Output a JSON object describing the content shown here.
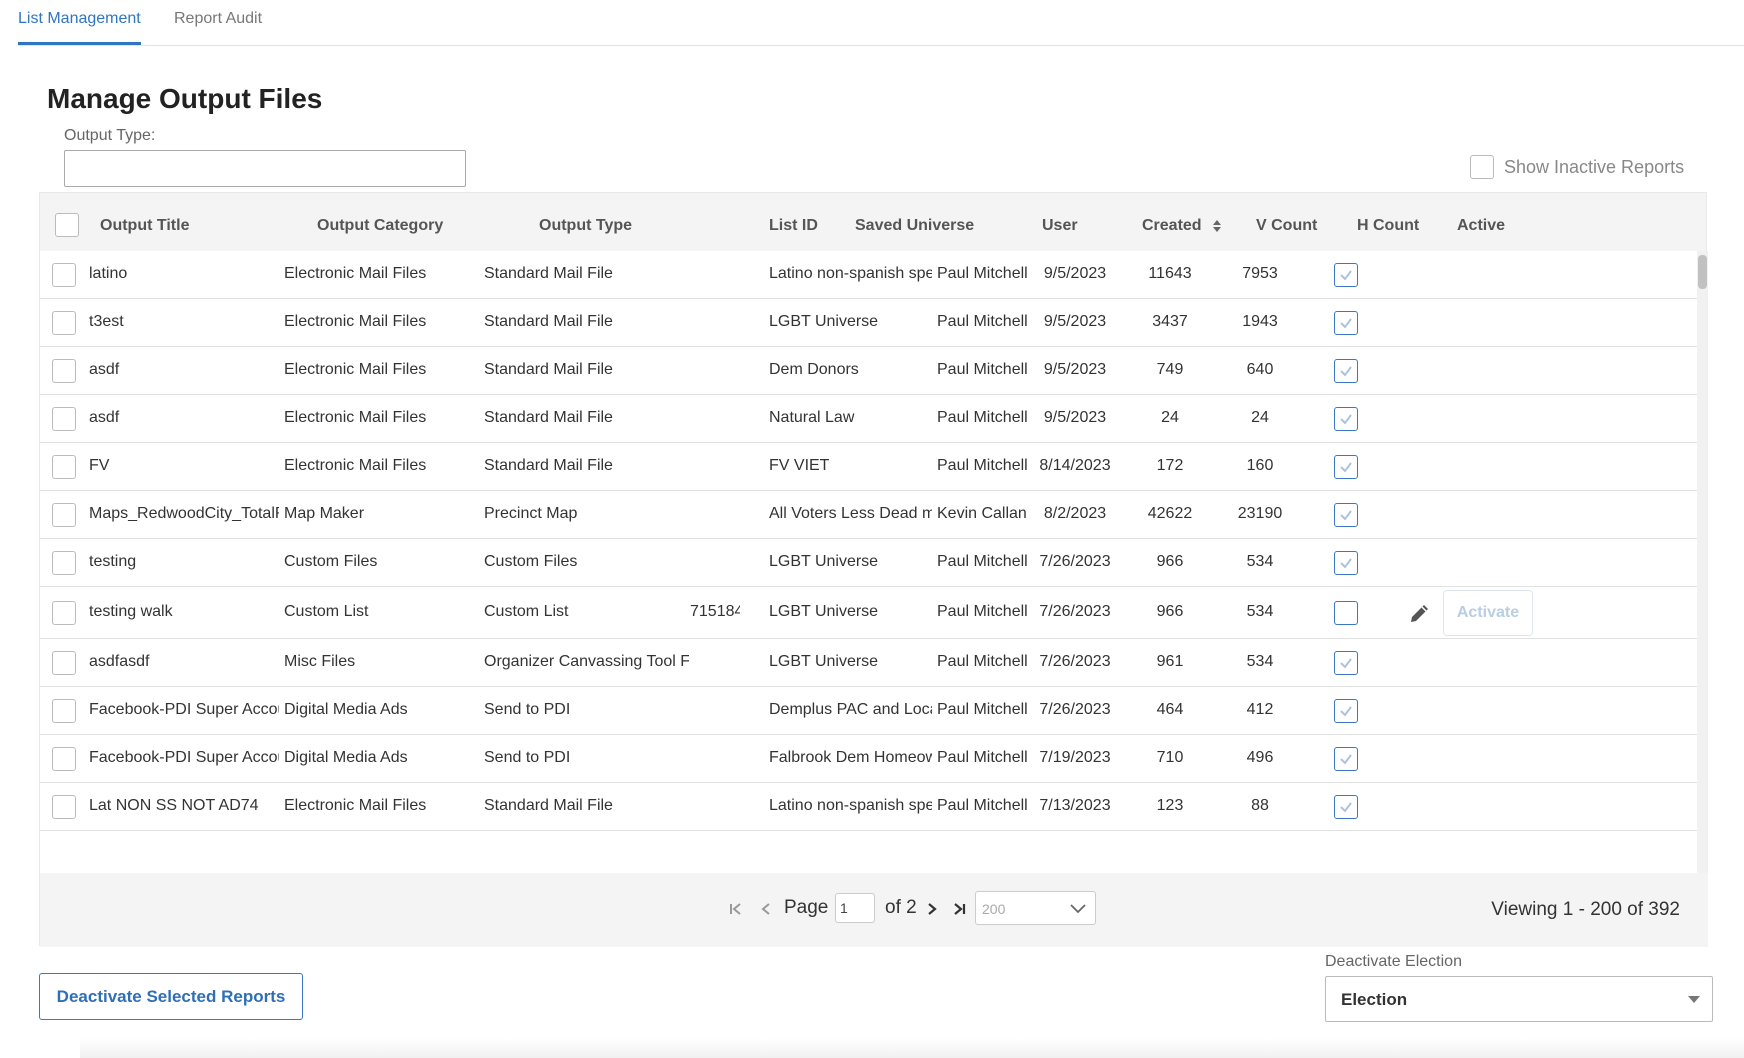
{
  "tabs": [
    {
      "label": "List Management",
      "active": true
    },
    {
      "label": "Report Audit",
      "active": false
    }
  ],
  "page_title": "Manage Output Files",
  "filter": {
    "output_type_label": "Output Type:",
    "output_type_value": ""
  },
  "show_inactive_label": "Show Inactive Reports",
  "table": {
    "columns": [
      "Output Title",
      "Output Category",
      "Output Type",
      "List ID",
      "Saved Universe",
      "User",
      "Created",
      "V Count",
      "H Count",
      "Active"
    ],
    "sorted_column": "Created",
    "rows": [
      {
        "title": "latino",
        "category": "Electronic Mail Files",
        "type": "Standard Mail File",
        "list_id": "",
        "universe": "Latino non-spanish speak",
        "user": "Paul Mitchell",
        "created": "9/5/2023",
        "v_count": "11643",
        "h_count": "7953"
      },
      {
        "title": "t3est",
        "category": "Electronic Mail Files",
        "type": "Standard Mail File",
        "list_id": "",
        "universe": "LGBT Universe",
        "user": "Paul Mitchell",
        "created": "9/5/2023",
        "v_count": "3437",
        "h_count": "1943"
      },
      {
        "title": "asdf",
        "category": "Electronic Mail Files",
        "type": "Standard Mail File",
        "list_id": "",
        "universe": "Dem Donors",
        "user": "Paul Mitchell",
        "created": "9/5/2023",
        "v_count": "749",
        "h_count": "640"
      },
      {
        "title": "asdf",
        "category": "Electronic Mail Files",
        "type": "Standard Mail File",
        "list_id": "",
        "universe": "Natural Law",
        "user": "Paul Mitchell",
        "created": "9/5/2023",
        "v_count": "24",
        "h_count": "24"
      },
      {
        "title": "FV",
        "category": "Electronic Mail Files",
        "type": "Standard Mail File",
        "list_id": "",
        "universe": "FV VIET",
        "user": "Paul Mitchell",
        "created": "8/14/2023",
        "v_count": "172",
        "h_count": "160"
      },
      {
        "title": "Maps_RedwoodCity_TotalRe",
        "category": "Map Maker",
        "type": "Precinct Map",
        "list_id": "",
        "universe": "All Voters Less Dead mov",
        "user": "Kevin Callan",
        "created": "8/2/2023",
        "v_count": "42622",
        "h_count": "23190"
      },
      {
        "title": "testing",
        "category": "Custom Files",
        "type": "Custom Files",
        "list_id": "",
        "universe": "LGBT Universe",
        "user": "Paul Mitchell",
        "created": "7/26/2023",
        "v_count": "966",
        "h_count": "534"
      },
      {
        "title": "testing walk",
        "category": "Custom List",
        "type": "Custom List",
        "list_id": "715184",
        "universe": "LGBT Universe",
        "user": "Paul Mitchell",
        "created": "7/26/2023",
        "v_count": "966",
        "h_count": "534",
        "hovered": true
      },
      {
        "title": "asdfasdf",
        "category": "Misc Files",
        "type": "Organizer Canvassing Tool File",
        "list_id": "",
        "universe": "LGBT Universe",
        "user": "Paul Mitchell",
        "created": "7/26/2023",
        "v_count": "961",
        "h_count": "534"
      },
      {
        "title": "Facebook-PDI Super Account",
        "category": "Digital Media Ads",
        "type": "Send to PDI",
        "list_id": "",
        "universe": "Demplus PAC and Local",
        "user": "Paul Mitchell",
        "created": "7/26/2023",
        "v_count": "464",
        "h_count": "412"
      },
      {
        "title": "Facebook-PDI Super Account",
        "category": "Digital Media Ads",
        "type": "Send to PDI",
        "list_id": "",
        "universe": "Falbrook Dem Homeown",
        "user": "Paul Mitchell",
        "created": "7/19/2023",
        "v_count": "710",
        "h_count": "496"
      },
      {
        "title": "Lat NON SS NOT AD74",
        "category": "Electronic Mail Files",
        "type": "Standard Mail File",
        "list_id": "",
        "universe": "Latino non-spanish speak",
        "user": "Paul Mitchell",
        "created": "7/13/2023",
        "v_count": "123",
        "h_count": "88"
      }
    ],
    "row_action_label": "Activate"
  },
  "pager": {
    "page_label": "Page",
    "current_page": "1",
    "of_label": "of 2",
    "page_size": "200",
    "viewing": "Viewing 1 - 200 of 392"
  },
  "footer": {
    "deactivate_button": "Deactivate Selected Reports",
    "deactivate_election_label": "Deactivate Election",
    "election_value": "Election"
  },
  "colors": {
    "accent": "#2f76c0",
    "check": "#a9c4e4",
    "activate_disabled": "#b9cde3"
  }
}
